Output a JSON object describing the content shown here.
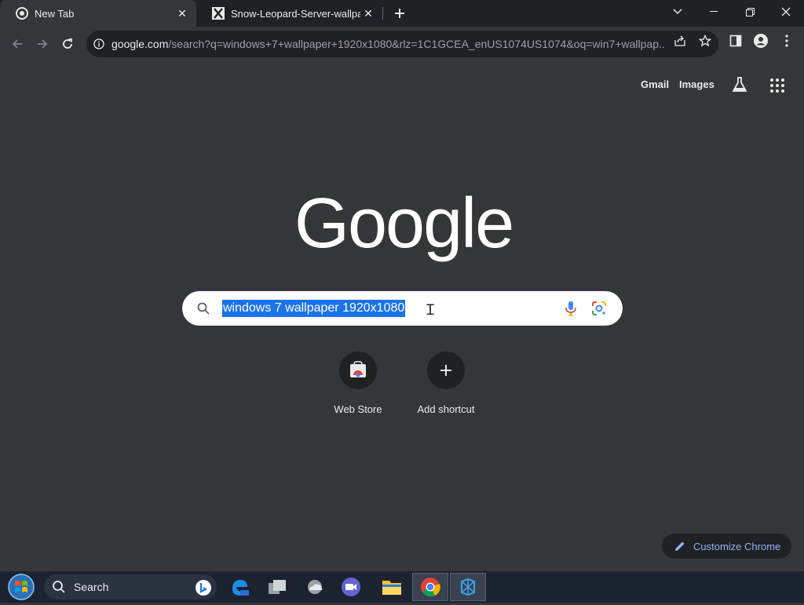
{
  "tabs": [
    {
      "title": "New Tab",
      "favicon": "chrome-icon",
      "active": true
    },
    {
      "title": "Snow-Leopard-Server-wallpaper.j",
      "favicon": "x-icon",
      "active": false
    }
  ],
  "omnibox": {
    "url_host": "google.com",
    "url_rest": "/search?q=windows+7+wallpaper+1920x1080&rlz=1C1GCEA_enUS1074US1074&oq=win7+wallpap..."
  },
  "header_links": {
    "gmail": "Gmail",
    "images": "Images"
  },
  "logo": "Google",
  "search": {
    "query": "windows 7 wallpaper 1920x1080"
  },
  "shortcuts": [
    {
      "label": "Web Store",
      "icon": "web-store-icon"
    },
    {
      "label": "Add shortcut",
      "icon": "plus-icon"
    }
  ],
  "customize": {
    "label": "Customize Chrome"
  },
  "taskbar": {
    "search_label": "Search"
  },
  "colors": {
    "accent": "#8ab4f8",
    "selection": "#1a73e8",
    "background": "#35363a",
    "frame": "#202124"
  }
}
